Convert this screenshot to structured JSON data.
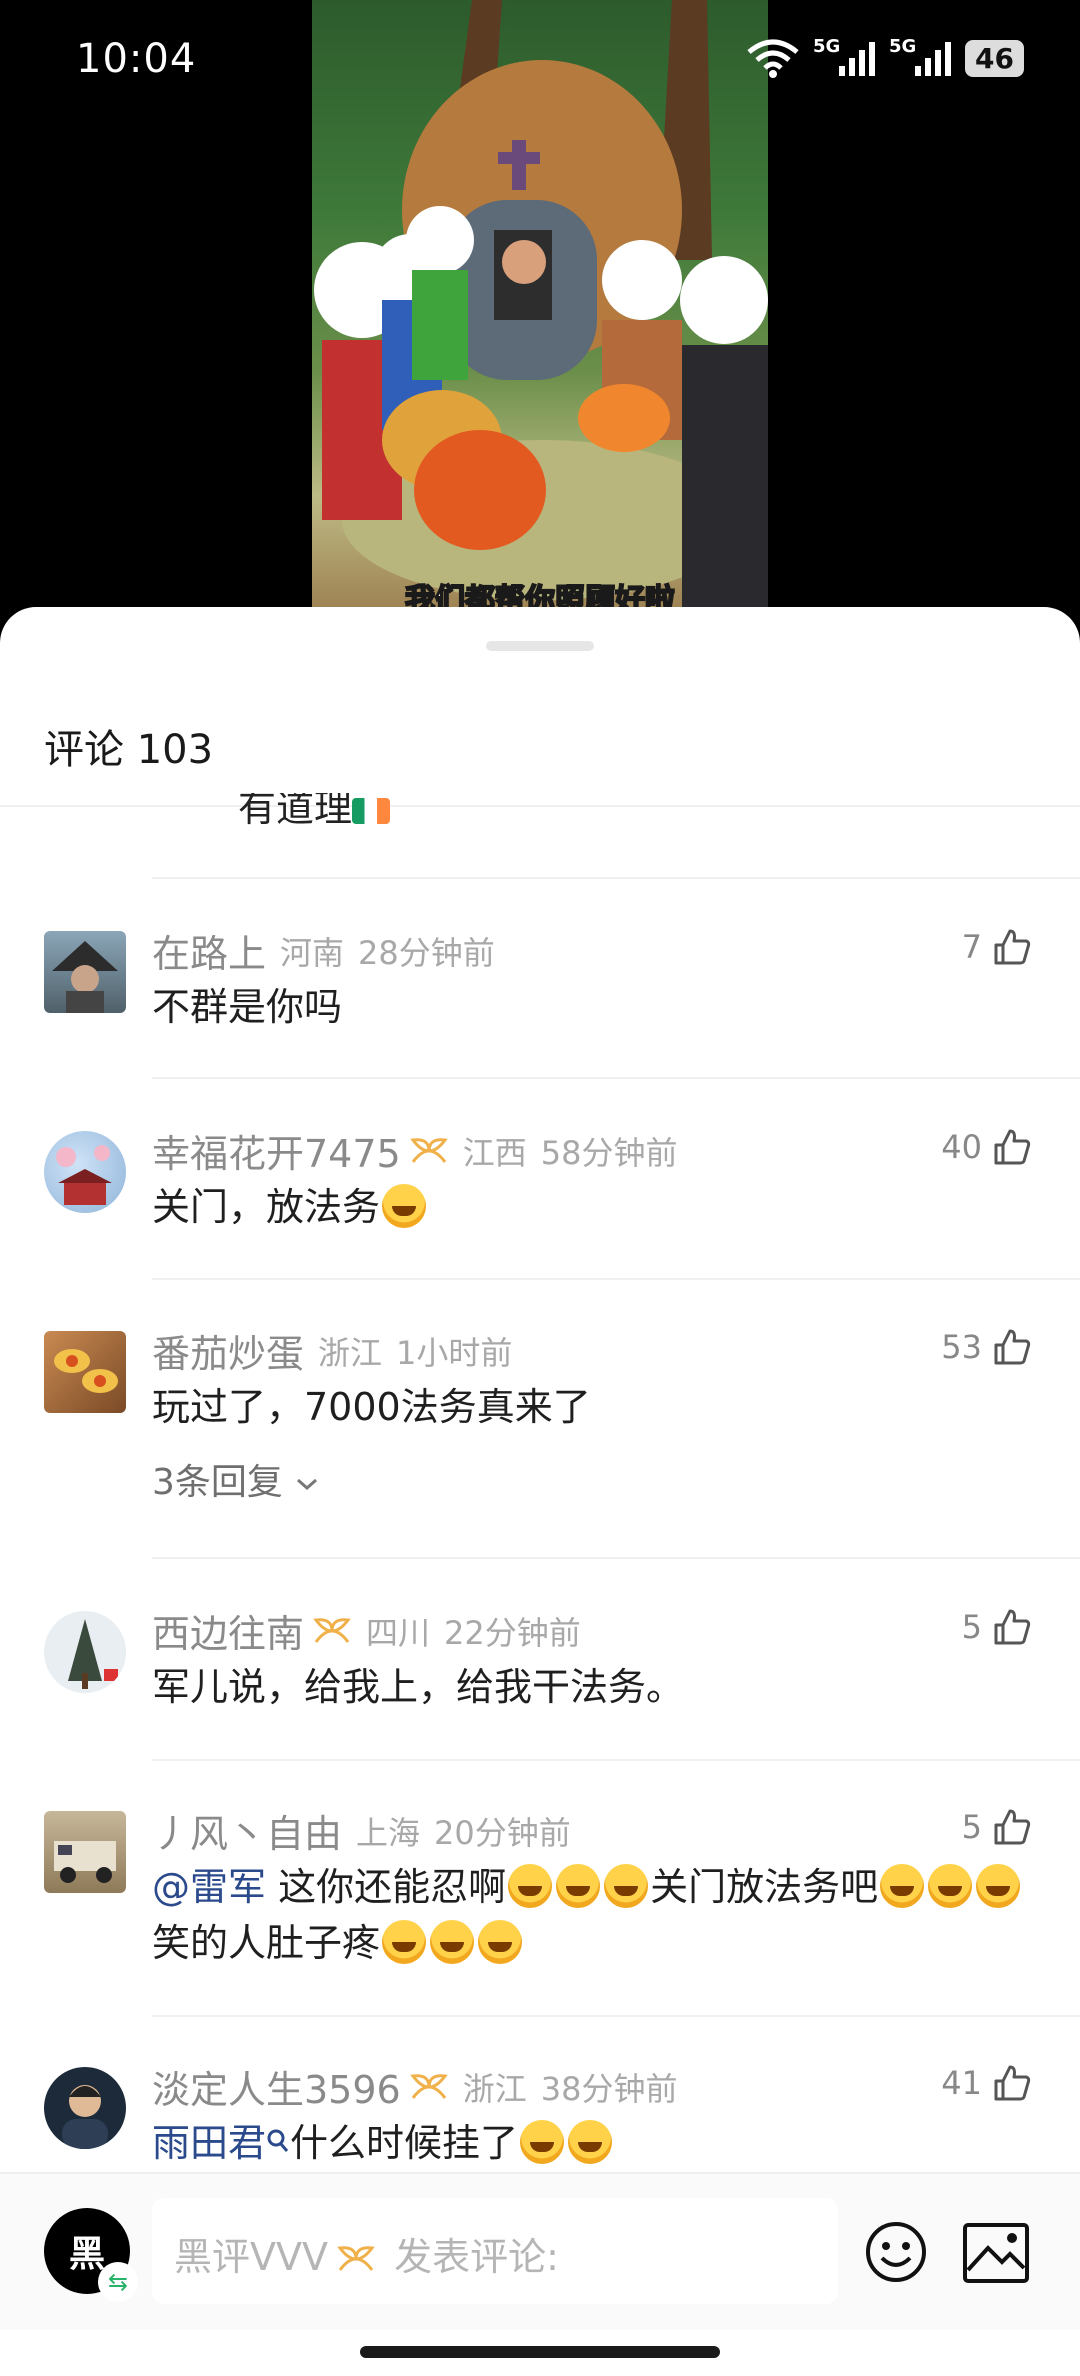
{
  "status_bar": {
    "time": "10:04",
    "network_1": "5G",
    "network_2": "5G",
    "battery": "46"
  },
  "video": {
    "subtitle": "我们都帮你照顾好啦"
  },
  "sheet": {
    "title": "评论 103"
  },
  "partial_comment": {
    "text": "有道理"
  },
  "comments": [
    {
      "name": "在路上",
      "location": "河南",
      "time": "28分钟前",
      "likes": "7",
      "text": "不群是你吗",
      "vip": false
    },
    {
      "name": "幸福花开7475",
      "location": "江西",
      "time": "58分钟前",
      "likes": "40",
      "text": "关门，放法务",
      "vip": true
    },
    {
      "name": "番茄炒蛋",
      "location": "浙江",
      "time": "1小时前",
      "likes": "53",
      "text": "玩过了，7000法务真来了",
      "replies": "3条回复",
      "vip": false
    },
    {
      "name": "西边往南",
      "location": "四川",
      "time": "22分钟前",
      "likes": "5",
      "text": "军儿说，给我上，给我干法务。",
      "vip": true
    },
    {
      "name": "丿风丶自由",
      "location": "上海",
      "time": "20分钟前",
      "likes": "5",
      "mention": "@雷军",
      "text_1": " 这你还能忍啊",
      "text_2": "关门放法务吧",
      "text_3": "笑的人肚子疼",
      "vip": false
    },
    {
      "name": "淡定人生3596",
      "location": "浙江",
      "time": "38分钟前",
      "likes": "41",
      "mention": "雨田君",
      "text": "什么时候挂了",
      "vip": true
    }
  ],
  "composer": {
    "avatar_char": "黑",
    "user": "黑评VVV",
    "placeholder": "发表评论:"
  },
  "icons": [
    "wifi-icon",
    "signal-icon",
    "battery-icon",
    "like-icon",
    "vip-icon",
    "chevron-down-icon",
    "emoji-icon",
    "image-icon"
  ]
}
